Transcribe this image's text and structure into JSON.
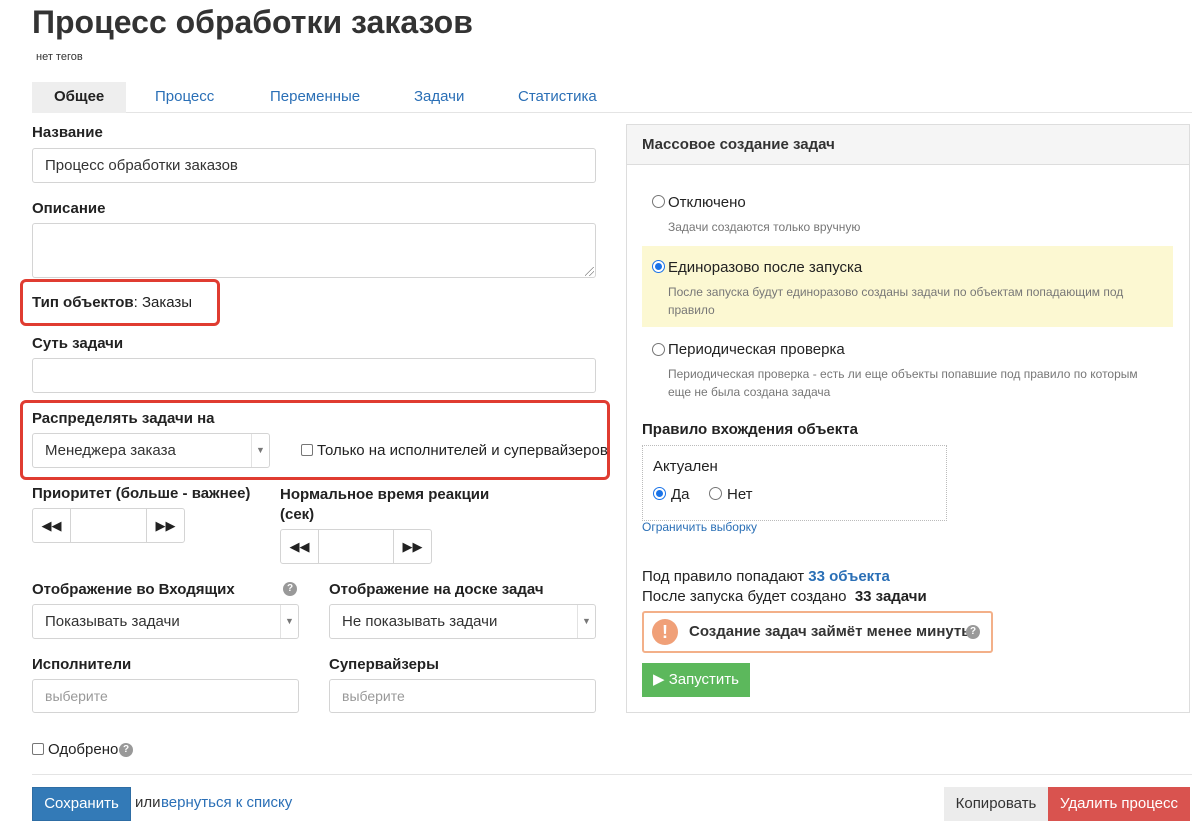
{
  "page": {
    "title": "Процесс обработки заказов",
    "tags": "нет тегов"
  },
  "tabs": [
    {
      "label": "Общее",
      "active": true
    },
    {
      "label": "Процесс"
    },
    {
      "label": "Переменные"
    },
    {
      "label": "Задачи"
    },
    {
      "label": "Статистика"
    }
  ],
  "form": {
    "name_label": "Название",
    "name_value": "Процесс обработки заказов",
    "description_label": "Описание",
    "description_value": "",
    "object_type_label": "Тип объектов",
    "object_type_sep": ":",
    "object_type_value": "Заказы",
    "task_essence_label": "Суть задачи",
    "task_essence_value": "",
    "distribute_label": "Распределять задачи на",
    "distribute_value": "Менеджера заказа",
    "only_executors_label": "Только на исполнителей и супервайзеров",
    "priority_label": "Приоритет (больше - важнее)",
    "reaction_label_line1": "Нормальное время реакции",
    "reaction_label_line2": "(сек)",
    "inbox_display_label": "Отображение во Входящих",
    "inbox_display_value": "Показывать задачи",
    "board_display_label": "Отображение на доске задач",
    "board_display_value": "Не показывать задачи",
    "executors_label": "Исполнители",
    "executors_placeholder": "выберите",
    "supervisors_label": "Супервайзеры",
    "supervisors_placeholder": "выберите",
    "approved_label": "Одобрено",
    "save_label": "Сохранить",
    "or_text": "или",
    "back_link": "вернуться к списку",
    "copy_label": "Копировать",
    "delete_label": "Удалить процесс"
  },
  "icons": {
    "stepper_left": "fast-backward-icon",
    "stepper_right": "fast-forward-icon",
    "help": "question-circle-icon",
    "warning": "exclamation-circle-icon",
    "play": "play-icon",
    "select_arrow": "chevron-down-icon"
  },
  "mass": {
    "header": "Массовое создание задач",
    "options": [
      {
        "label": "Отключено",
        "hint": "Задачи создаются только вручную",
        "checked": false
      },
      {
        "label": "Единоразово после запуска",
        "hint_line1": "После запуска будут единоразово созданы задачи по объектам попадающим под",
        "hint_line2": "правило",
        "checked": true
      },
      {
        "label": "Периодическая проверка",
        "hint_line1": "Периодическая проверка - есть ли еще объекты попавшие под правило по которым",
        "hint_line2": "еще не была создана задача",
        "checked": false
      }
    ],
    "rule_label": "Правило вхождения объекта",
    "rule_field": "Актуален",
    "rule_yes": "Да",
    "rule_no": "Нет",
    "limit_link": "Ограничить выборку",
    "fall_text": "Под правило попадают",
    "fall_count": "33 объекта",
    "created_text": "После запуска будет создано",
    "created_count": "33 задачи",
    "warning_text": "Создание задач займёт менее минуты",
    "run_label": "Запустить"
  },
  "colors": {
    "accent": "#337ab7",
    "danger": "#d9534f",
    "success": "#5cb85c",
    "highlight": "#e03c31"
  }
}
